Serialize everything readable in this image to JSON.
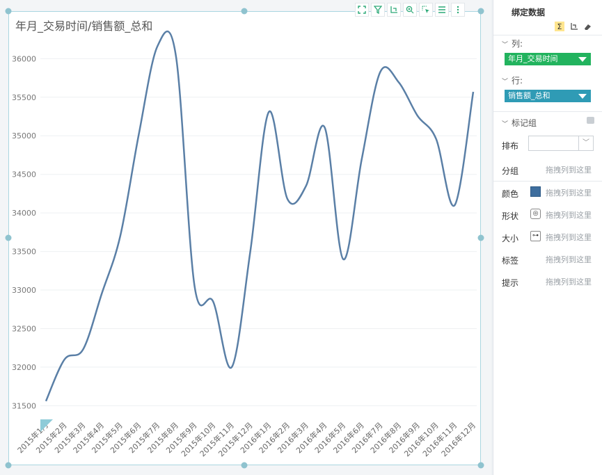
{
  "chart_title": "年月_交易时间/销售额_总和",
  "toolbar": {
    "icons": [
      "fullscreen-icon",
      "filter-icon",
      "axis-swap-icon",
      "zoom-icon",
      "select-icon",
      "list-icon",
      "more-icon"
    ]
  },
  "panel": {
    "title": "绑定数据",
    "tools": [
      "sigma-icon",
      "axis-icon",
      "eraser-icon"
    ],
    "columns_label": "列:",
    "columns_field": "年月_交易时间",
    "rows_label": "行:",
    "rows_field": "销售额_总和",
    "marks_label": "标记组",
    "layout_label": "排布",
    "group_label": "分组",
    "color_label": "颜色",
    "shape_label": "形状",
    "size_label": "大小",
    "tag_label": "标签",
    "tip_label": "提示",
    "drop_hint": "拖拽列到这里",
    "colors": {
      "green": "#22b35e",
      "teal": "#2f9bb5"
    }
  },
  "chart_data": {
    "type": "line",
    "categories": [
      "2015年1月",
      "2015年2月",
      "2015年3月",
      "2015年4月",
      "2015年5月",
      "2015年6月",
      "2015年7月",
      "2015年8月",
      "2015年9月",
      "2015年10月",
      "2015年11月",
      "2015年12月",
      "2016年1月",
      "2016年2月",
      "2016年3月",
      "2016年4月",
      "2016年5月",
      "2016年6月",
      "2016年7月",
      "2016年8月",
      "2016年9月",
      "2016年10月",
      "2016年11月",
      "2016年12月"
    ],
    "series": [
      {
        "values": [
          31560,
          32100,
          32230,
          32950,
          33700,
          35020,
          36160,
          36030,
          33050,
          32850,
          32000,
          33500,
          35310,
          34180,
          34350,
          35110,
          33400,
          34700,
          35830,
          35690,
          35260,
          34960,
          34100,
          35570
        ]
      }
    ],
    "yticks": [
      31500,
      32000,
      32500,
      33000,
      33500,
      34000,
      34500,
      35000,
      35500,
      36000
    ],
    "ylim": [
      31350,
      36400
    ],
    "grid": true,
    "line_color": "#5a7fa6"
  }
}
